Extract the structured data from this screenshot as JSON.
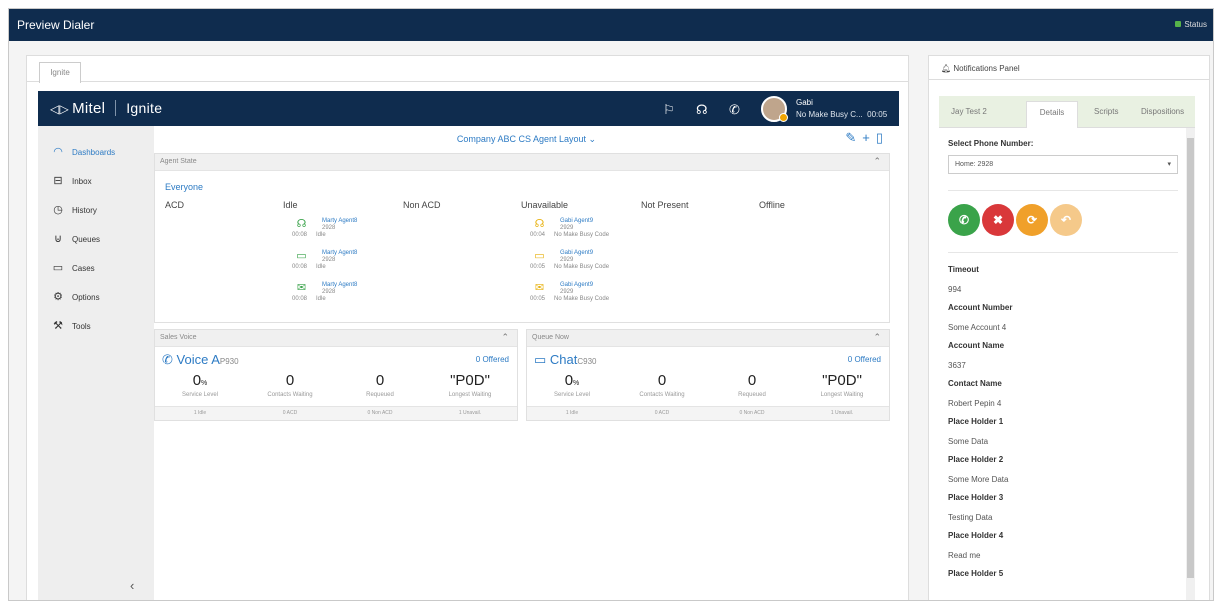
{
  "window": {
    "title": "Preview Dialer",
    "status": "Status"
  },
  "tab": "Ignite",
  "app": {
    "brand": "Mitel",
    "product": "Ignite",
    "user": {
      "name": "Gabi",
      "status": "No Make Busy C...",
      "timer": "00:05"
    }
  },
  "nav": [
    {
      "label": "Dashboards",
      "icon": "dashboard-icon"
    },
    {
      "label": "Inbox",
      "icon": "inbox-icon"
    },
    {
      "label": "History",
      "icon": "history-icon"
    },
    {
      "label": "Queues",
      "icon": "queues-icon"
    },
    {
      "label": "Cases",
      "icon": "cases-icon"
    },
    {
      "label": "Options",
      "icon": "gear-icon"
    },
    {
      "label": "Tools",
      "icon": "wrench-icon"
    }
  ],
  "layout_title": "Company ABC CS Agent Layout",
  "agent_state": {
    "header": "Agent State",
    "filter": "Everyone",
    "columns": [
      "ACD",
      "Idle",
      "Non ACD",
      "Unavailable",
      "Not Present",
      "Offline"
    ],
    "idle_agents": [
      {
        "name": "Marty Agent8",
        "ext": "2928",
        "time": "00:08",
        "state": "Idle",
        "icon": "headset-icon"
      },
      {
        "name": "Marty Agent8",
        "ext": "2928",
        "time": "00:08",
        "state": "Idle",
        "icon": "chat-icon"
      },
      {
        "name": "Marty Agent8",
        "ext": "2928",
        "time": "00:08",
        "state": "Idle",
        "icon": "email-icon"
      }
    ],
    "unavailable_agents": [
      {
        "name": "Gabi Agent9",
        "ext": "2929",
        "time": "00:04",
        "state": "No Make Busy Code",
        "icon": "headset-icon"
      },
      {
        "name": "Gabi Agent9",
        "ext": "2929",
        "time": "00:05",
        "state": "No Make Busy Code",
        "icon": "chat-icon"
      },
      {
        "name": "Gabi Agent9",
        "ext": "2929",
        "time": "00:05",
        "state": "No Make Busy Code",
        "icon": "email-icon"
      }
    ]
  },
  "queues": [
    {
      "header": "Sales Voice",
      "name": "Voice A",
      "code": "P930",
      "offered": "0 Offered",
      "icon": "phone-icon",
      "stats": [
        {
          "v": "0",
          "u": "%",
          "l": "Service Level"
        },
        {
          "v": "0",
          "u": "",
          "l": "Contacts Waiting"
        },
        {
          "v": "0",
          "u": "",
          "l": "Requeued"
        },
        {
          "v": "\"P0D\"",
          "u": "",
          "l": "Longest Waiting"
        }
      ],
      "foot": [
        "1 Idle",
        "0 ACD",
        "0 Non ACD",
        "1 Unavail."
      ]
    },
    {
      "header": "Queue Now",
      "name": "Chat",
      "code": "C930",
      "offered": "0 Offered",
      "icon": "chat-icon",
      "stats": [
        {
          "v": "0",
          "u": "%",
          "l": "Service Level"
        },
        {
          "v": "0",
          "u": "",
          "l": "Contacts Waiting"
        },
        {
          "v": "0",
          "u": "",
          "l": "Requeued"
        },
        {
          "v": "\"P0D\"",
          "u": "",
          "l": "Longest Waiting"
        }
      ],
      "foot": [
        "1 Idle",
        "0 ACD",
        "0 Non ACD",
        "1 Unavail."
      ]
    }
  ],
  "notifications": {
    "title": "Notifications Panel",
    "tabs": [
      "Jay Test 2",
      "Details",
      "Scripts",
      "Dispositions"
    ],
    "phone_label": "Select Phone Number:",
    "phone_value": "Home: 2928",
    "fields": [
      {
        "k": "Timeout",
        "v": "994"
      },
      {
        "k": "Account Number",
        "v": "Some Account 4"
      },
      {
        "k": "Account Name",
        "v": "3637"
      },
      {
        "k": "Contact Name",
        "v": "Robert Pepin 4"
      },
      {
        "k": "Place Holder 1",
        "v": "Some Data"
      },
      {
        "k": "Place Holder 2",
        "v": "Some More Data"
      },
      {
        "k": "Place Holder 3",
        "v": "Testing Data"
      },
      {
        "k": "Place Holder 4",
        "v": "Read me"
      },
      {
        "k": "Place Holder 5",
        "v": ""
      }
    ],
    "buttons": [
      {
        "name": "accept-call-button",
        "color": "#3aa34a",
        "glyph": "✆"
      },
      {
        "name": "reject-call-button",
        "color": "#d9383a",
        "glyph": "✖"
      },
      {
        "name": "skip-call-button",
        "color": "#f0a02a",
        "glyph": "⟳"
      },
      {
        "name": "return-call-button",
        "color": "#f5c98a",
        "glyph": "↶"
      }
    ]
  },
  "colors": {
    "header": "#0f2c4e",
    "accent": "#2d7bc4"
  }
}
